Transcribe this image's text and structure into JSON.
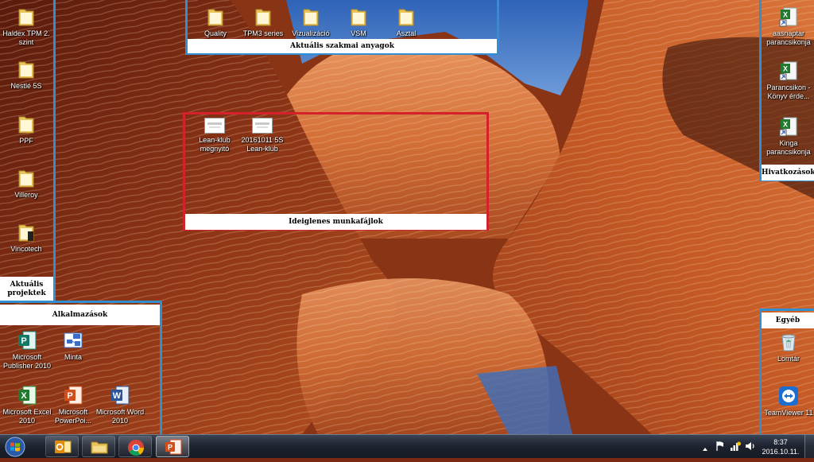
{
  "fences": {
    "projects": {
      "title": "Aktuális projektek"
    },
    "materials": {
      "title": "Aktuális szakmai anyagok"
    },
    "temp": {
      "title": "Ideiglenes munkafájlok"
    },
    "apps": {
      "title": "Alkalmazások"
    },
    "shortcuts": {
      "title": "Hivatkozások"
    },
    "other": {
      "title": "Egyéb"
    }
  },
  "icons": {
    "projects": [
      {
        "label": "Haldex TPM 2. szint",
        "icon": "folder-icon"
      },
      {
        "label": "Nestlé 5S",
        "icon": "folder-icon"
      },
      {
        "label": "PPF",
        "icon": "folder-icon"
      },
      {
        "label": "Villeroy",
        "icon": "folder-icon"
      },
      {
        "label": "Vincotech",
        "icon": "folder-icon"
      }
    ],
    "materials": [
      {
        "label": "Quality",
        "icon": "folder-icon"
      },
      {
        "label": "TPM3 series",
        "icon": "folder-icon"
      },
      {
        "label": "Vizualizáció",
        "icon": "folder-icon"
      },
      {
        "label": "VSM",
        "icon": "folder-icon"
      },
      {
        "label": "Asztal",
        "icon": "folder-icon"
      }
    ],
    "temp": [
      {
        "label": "Lean-klub megnyitó",
        "icon": "presentation-file-icon"
      },
      {
        "label": "20161011 5S Lean-klub",
        "icon": "presentation-file-icon"
      }
    ],
    "apps": [
      {
        "label": "Microsoft Publisher 2010",
        "icon": "publisher-icon"
      },
      {
        "label": "Minta",
        "icon": "visio-icon"
      },
      {
        "label": "Microsoft Excel 2010",
        "icon": "excel-icon"
      },
      {
        "label": "Microsoft PowerPoi...",
        "icon": "powerpoint-icon"
      },
      {
        "label": "Microsoft Word 2010",
        "icon": "word-icon"
      }
    ],
    "shortcuts": [
      {
        "label": "aasnaptar parancsikonja",
        "icon": "excel-shortcut-icon"
      },
      {
        "label": "Parancsikon - Könyv érde...",
        "icon": "excel-shortcut-icon"
      },
      {
        "label": "Kinga parancsikonja",
        "icon": "excel-shortcut-icon"
      }
    ],
    "other": [
      {
        "label": "Lomtár",
        "icon": "recycle-bin-icon"
      },
      {
        "label": "TeamViewer 11",
        "icon": "teamviewer-icon"
      }
    ]
  },
  "taskbar": {
    "buttons": [
      {
        "name": "outlook",
        "icon": "outlook-icon"
      },
      {
        "name": "explorer",
        "icon": "folder-icon"
      },
      {
        "name": "chrome",
        "icon": "chrome-icon"
      },
      {
        "name": "powerpoint",
        "icon": "powerpoint-icon"
      }
    ],
    "clock": {
      "time": "8:37",
      "date": "2016.10.11."
    }
  },
  "colors": {
    "fence_blue": "#2f8fd1",
    "fence_red": "#d4222a",
    "fence_title_bg": "#ffffff"
  }
}
